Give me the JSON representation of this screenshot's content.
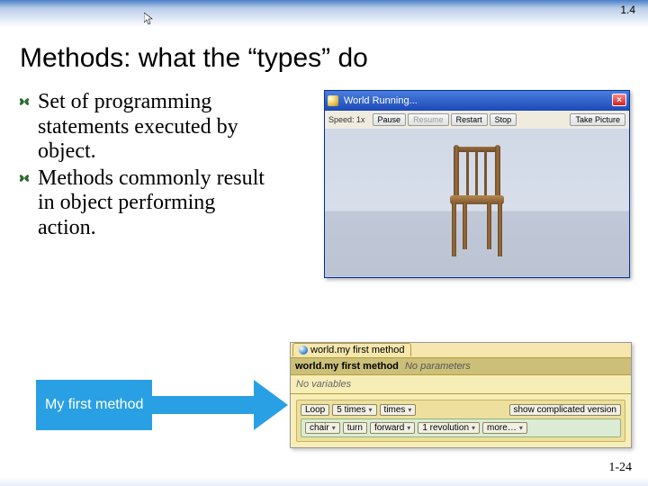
{
  "chapter_number": "1.4",
  "slide_title": "Methods: what the “types” do",
  "bullets": [
    "Set of programming statements executed by object.",
    "Methods commonly result in object performing action."
  ],
  "world_window": {
    "title": "World Running...",
    "close_label": "×",
    "speed_label": "Speed: 1x",
    "buttons": {
      "pause": "Pause",
      "resume": "Resume",
      "restart": "Restart",
      "stop": "Stop",
      "take_picture": "Take Picture"
    }
  },
  "method_panel": {
    "tab_label": "world.my first method",
    "header_method": "world.my first method",
    "header_params": "No parameters",
    "no_vars": "No variables",
    "loop": {
      "label": "Loop",
      "count": "5 times",
      "times_token": "times",
      "show_complicated": "show complicated version"
    },
    "action": {
      "subject": "chair",
      "verb": "turn",
      "direction": "forward",
      "amount": "1 revolution",
      "more": "more…"
    }
  },
  "callout_text": "My first method",
  "page_number": "1-24"
}
